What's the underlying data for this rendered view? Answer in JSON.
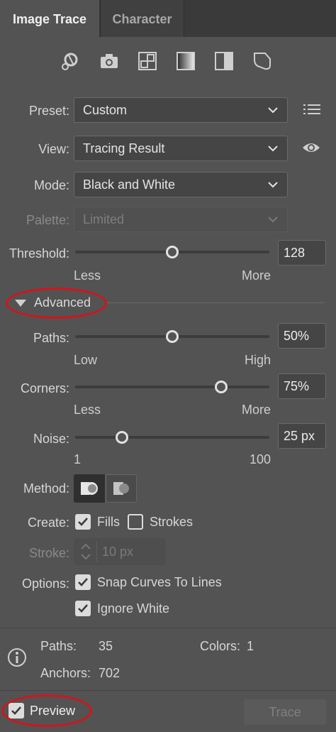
{
  "tabs": {
    "active": "Image Trace",
    "inactive": "Character"
  },
  "preset": {
    "label": "Preset:",
    "value": "Custom"
  },
  "view": {
    "label": "View:",
    "value": "Tracing Result"
  },
  "mode": {
    "label": "Mode:",
    "value": "Black and White"
  },
  "palette": {
    "label": "Palette:",
    "value": "Limited"
  },
  "threshold": {
    "label": "Threshold:",
    "value": "128",
    "min_label": "Less",
    "max_label": "More",
    "level": 0.5
  },
  "advanced": {
    "label": "Advanced"
  },
  "paths": {
    "label": "Paths:",
    "value": "50%",
    "min_label": "Low",
    "max_label": "High",
    "level": 0.5
  },
  "corners": {
    "label": "Corners:",
    "value": "75%",
    "min_label": "Less",
    "max_label": "More",
    "level": 0.75
  },
  "noise": {
    "label": "Noise:",
    "value": "25 px",
    "min_label": "1",
    "max_label": "100",
    "level": 0.24
  },
  "method": {
    "label": "Method:"
  },
  "create": {
    "label": "Create:",
    "fills": "Fills",
    "strokes": "Strokes"
  },
  "stroke": {
    "label": "Stroke:",
    "value": "10 px"
  },
  "options": {
    "label": "Options:",
    "snap": "Snap Curves To Lines",
    "ignore_white": "Ignore White"
  },
  "info": {
    "paths_label": "Paths:",
    "paths_value": "35",
    "colors_label": "Colors:",
    "colors_value": "1",
    "anchors_label": "Anchors:",
    "anchors_value": "702"
  },
  "footer": {
    "preview": "Preview",
    "trace": "Trace"
  },
  "colors": {
    "highlight": "#d3141b"
  }
}
